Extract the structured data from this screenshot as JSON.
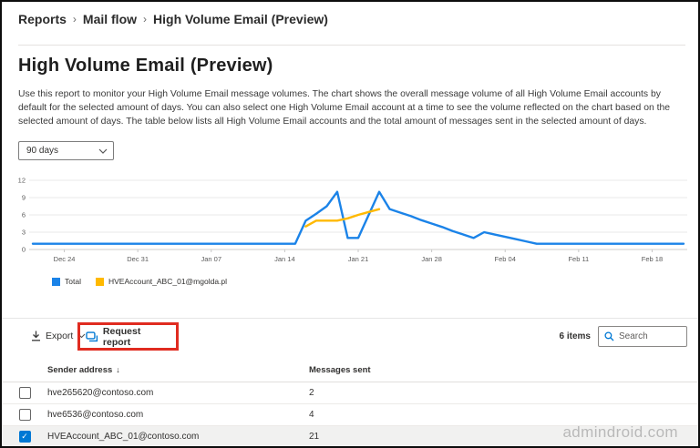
{
  "breadcrumb": {
    "separator": "›",
    "items": [
      "Reports",
      "Mail flow",
      "High Volume Email (Preview)"
    ]
  },
  "page": {
    "title": "High Volume Email (Preview)",
    "description": "Use this report to monitor your High Volume Email message volumes. The chart shows the overall message volume of all High Volume Email accounts by default for the selected amount of days. You can also select one High Volume Email account at a time to see the volume reflected on the chart based on the selected amount of days. The table below lists all High Volume Email accounts and the total amount of messages sent in the selected amount of days."
  },
  "filters": {
    "period_value": "90 days"
  },
  "chart_data": {
    "type": "line",
    "x": [
      "Dec 21",
      "Dec 22",
      "Dec 23",
      "Dec 24",
      "Dec 25",
      "Dec 26",
      "Dec 27",
      "Dec 28",
      "Dec 29",
      "Dec 30",
      "Dec 31",
      "Jan 01",
      "Jan 02",
      "Jan 03",
      "Jan 04",
      "Jan 05",
      "Jan 06",
      "Jan 07",
      "Jan 08",
      "Jan 09",
      "Jan 10",
      "Jan 11",
      "Jan 12",
      "Jan 13",
      "Jan 14",
      "Jan 15",
      "Jan 16",
      "Jan 17",
      "Jan 18",
      "Jan 19",
      "Jan 20",
      "Jan 21",
      "Jan 22",
      "Jan 23",
      "Jan 24",
      "Jan 25",
      "Jan 26",
      "Jan 27",
      "Jan 28",
      "Jan 29",
      "Jan 30",
      "Jan 31",
      "Feb 01",
      "Feb 02",
      "Feb 03",
      "Feb 04",
      "Feb 05",
      "Feb 06",
      "Feb 07",
      "Feb 08",
      "Feb 09",
      "Feb 10",
      "Feb 11",
      "Feb 12",
      "Feb 13",
      "Feb 14",
      "Feb 15",
      "Feb 16",
      "Feb 17",
      "Feb 18",
      "Feb 19",
      "Feb 20",
      "Feb 21"
    ],
    "xticks": [
      {
        "i": 3,
        "label": "Dec 24"
      },
      {
        "i": 10,
        "label": "Dec 31"
      },
      {
        "i": 17,
        "label": "Jan 07"
      },
      {
        "i": 24,
        "label": "Jan 14"
      },
      {
        "i": 31,
        "label": "Jan 21"
      },
      {
        "i": 38,
        "label": "Jan 28"
      },
      {
        "i": 45,
        "label": "Feb 04"
      },
      {
        "i": 52,
        "label": "Feb 11"
      },
      {
        "i": 59,
        "label": "Feb 18"
      }
    ],
    "ylim": [
      0,
      12
    ],
    "yticks": [
      0,
      3,
      6,
      9,
      12
    ],
    "grid": true,
    "legend_position": "bottom",
    "series": [
      {
        "name": "Total",
        "color": "#1b83e8",
        "start_index": 0,
        "values": [
          1,
          1,
          1,
          1,
          1,
          1,
          1,
          1,
          1,
          1,
          1,
          1,
          1,
          1,
          1,
          1,
          1,
          1,
          1,
          1,
          1,
          1,
          1,
          1,
          1,
          1,
          5,
          6.2,
          7.5,
          10,
          2,
          2,
          6,
          10,
          7,
          6.4,
          5.8,
          5.1,
          4.5,
          3.9,
          3.2,
          2.6,
          2,
          3,
          2.6,
          2.2,
          1.8,
          1.4,
          1,
          1,
          1,
          1,
          1,
          1,
          1,
          1,
          1,
          1,
          1,
          1,
          1,
          1,
          1
        ]
      },
      {
        "name": "HVEAccount_ABC_01@mgolda.pl",
        "color": "#ffb900",
        "start_index": 26,
        "values": [
          4,
          5,
          5,
          5,
          5.4,
          6,
          6.5,
          7
        ]
      }
    ]
  },
  "toolbar": {
    "export_label": "Export",
    "request_report_label": "Request report",
    "items_count": "6 items",
    "search_placeholder": "Search"
  },
  "table": {
    "headers": {
      "sender": "Sender address",
      "messages": "Messages sent"
    },
    "sort_glyph": "↓",
    "check_glyph": "✓",
    "rows": [
      {
        "sender": "hve265620@contoso.com",
        "messages": "2",
        "selected": false
      },
      {
        "sender": "hve6536@contoso.com",
        "messages": "4",
        "selected": false
      },
      {
        "sender": "HVEAccount_ABC_01@contoso.com",
        "messages": "21",
        "selected": true
      }
    ]
  },
  "watermark": "admindroid.com",
  "colors": {
    "accent_blue": "#0078d4",
    "chart_blue": "#1b83e8",
    "chart_yellow": "#ffb900",
    "annotation_red": "#e02b20",
    "selected_row_bg": "#f1f1f0"
  }
}
